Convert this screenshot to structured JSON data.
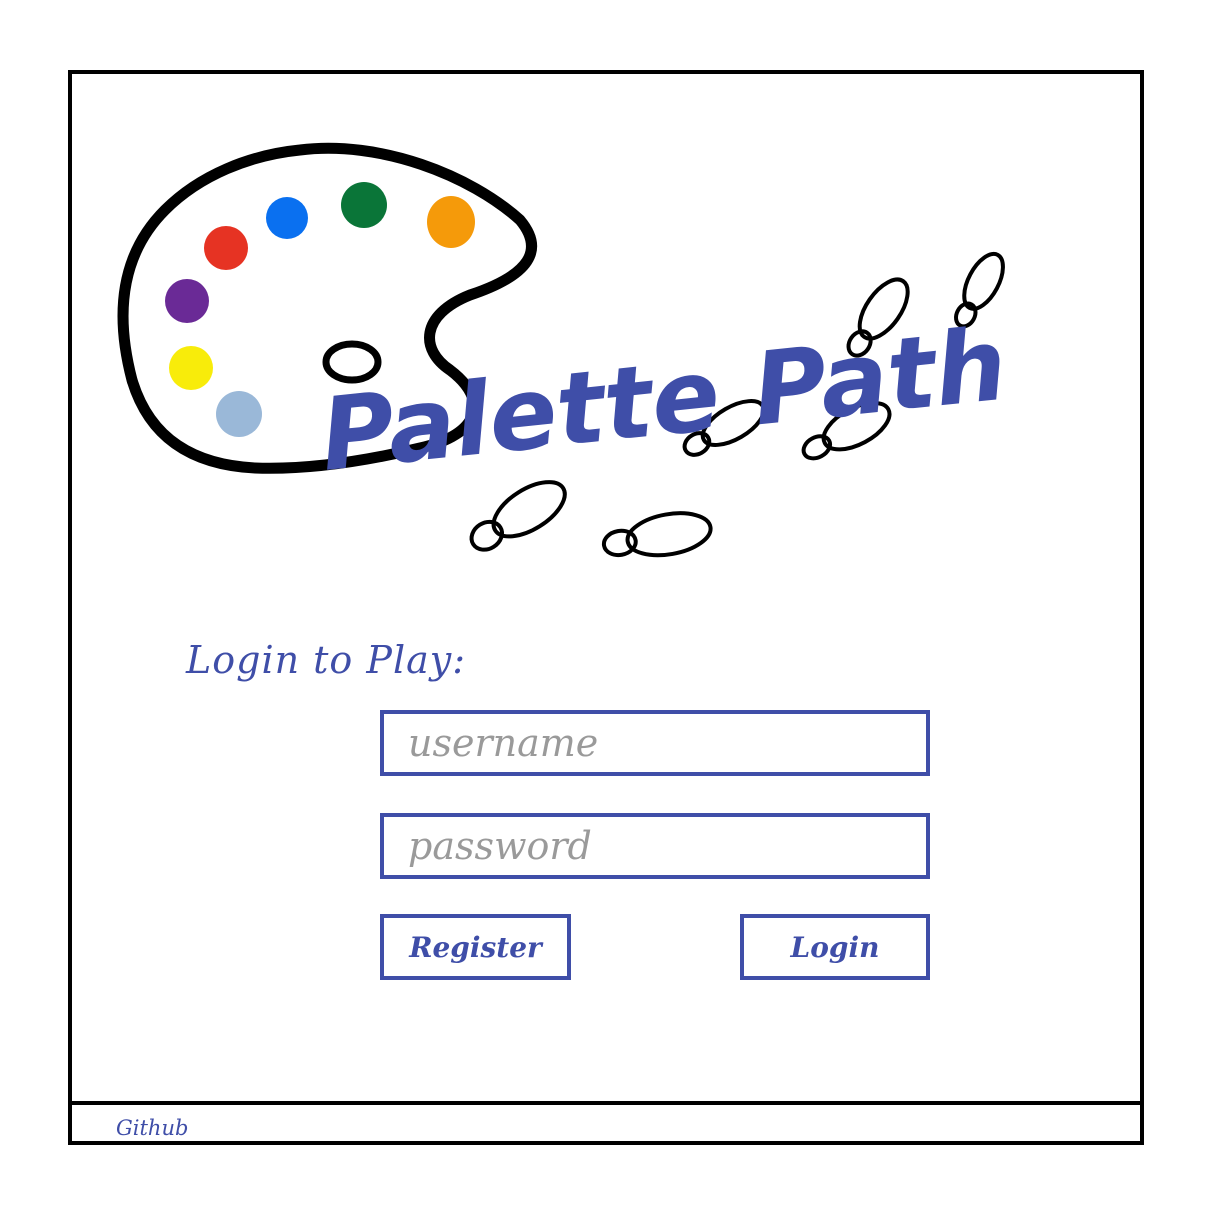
{
  "app": {
    "title": "Palette Path"
  },
  "colors": {
    "ink": "#3f4ea8",
    "paint_red": "#e63323",
    "paint_blue": "#0a70f0",
    "paint_green": "#0a7538",
    "paint_orange": "#f59a0a",
    "paint_purple": "#6a2a96",
    "paint_yellow": "#f8ec0a",
    "paint_lightblue": "#9ab8d8"
  },
  "logo": {
    "icon": "palette-icon",
    "decoration": "footprints-icon"
  },
  "login": {
    "heading": "Login to Play:",
    "username_placeholder": "username",
    "password_placeholder": "password",
    "register_label": "Register",
    "login_label": "Login"
  },
  "footer": {
    "link_label": "Github"
  }
}
